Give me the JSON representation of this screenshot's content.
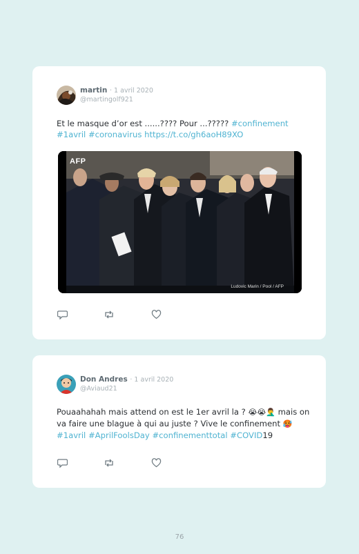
{
  "tweets": [
    {
      "author": "martin",
      "date": "· 1 avril 2020",
      "handle": "@martingolf921",
      "text_plain_1": "Et le masque d’or est ......???? Pour ...????? ",
      "tag_confinement": "#confinement",
      "tag_1avril": "#1avril",
      "tag_coronavirus": "#coronavirus",
      "link": "https://t.co/gh6aoH89XO",
      "image": {
        "watermark_top": "AFP",
        "credit": "Ludovic Marin / Pool / AFP"
      }
    },
    {
      "author": "Don Andres",
      "date": "· 1 avril 2020",
      "handle": "@Aviaud21",
      "text_plain_1": "Pouaahahah mais attend on est le 1er avril la ? ",
      "emojis_1": "😭😭🤦‍♂️",
      "text_plain_2": " mais on va faire une blague à qui au juste ? Vive le confinement ",
      "emoji_2": "🥵",
      "tag_1avril": "#1avril",
      "tag_aprilfools": "#AprilFoolsDay",
      "tag_confinementtotal": "#confinementtotal",
      "tag_covid": "#COVID",
      "text_tail": "19"
    }
  ],
  "page_number": "76",
  "colors": {
    "background": "#dff1f1",
    "card": "#ffffff",
    "link": "#4fb3d1"
  },
  "icons": [
    "reply-icon",
    "retweet-icon",
    "like-icon"
  ]
}
